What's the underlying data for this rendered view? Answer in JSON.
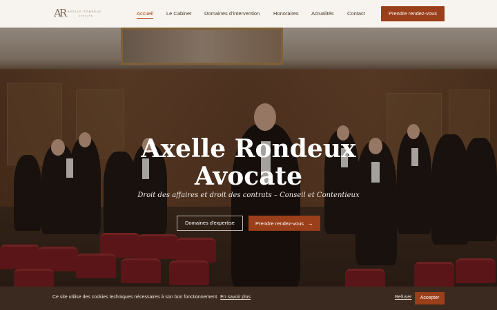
{
  "brand": {
    "logo_mark": "AR",
    "logo_name": "Axelle Rondeux",
    "logo_sub": "Avocate"
  },
  "nav": {
    "items": [
      {
        "label": "Accueil",
        "active": true
      },
      {
        "label": "Le Cabinet",
        "active": false
      },
      {
        "label": "Domaines d'intervention",
        "active": false
      },
      {
        "label": "Honoraires",
        "active": false
      },
      {
        "label": "Actualités",
        "active": false
      },
      {
        "label": "Contact",
        "active": false
      }
    ],
    "cta_label": "Prendre rendez-vous"
  },
  "hero": {
    "title_line1": "Axelle Rondeux",
    "title_line2": "Avocate",
    "subtitle": "Droit des affaires et droit des contrats – Conseil et Contentieux",
    "btn_secondary": "Domaines d'expertise",
    "btn_primary": "Prendre rendez-vous",
    "btn_primary_icon": "arrow-right-icon"
  },
  "cookie": {
    "text": "Ce site utilise des cookies techniques nécessaires à son bon fonctionnement.",
    "link": "En savoir plus",
    "refuse": "Refuser",
    "accept": "Accepter"
  },
  "colors": {
    "accent": "#9a3f1a",
    "background": "#f7f3ee",
    "cookie_bar": "#3a2a20"
  }
}
